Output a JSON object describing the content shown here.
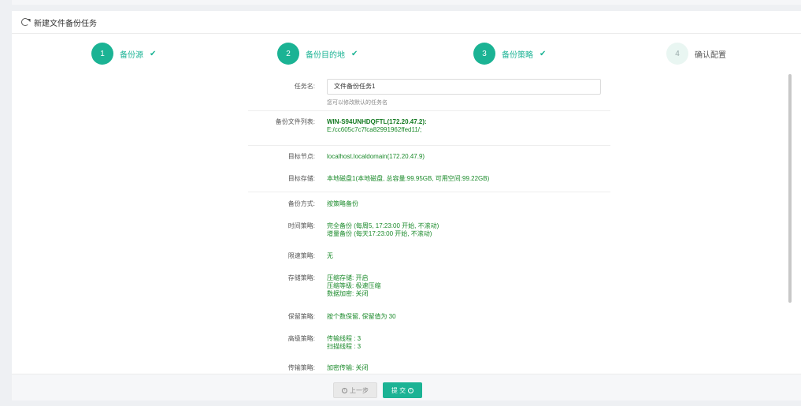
{
  "header": {
    "title": "新建文件备份任务"
  },
  "steps": [
    {
      "num": "1",
      "label": "备份源",
      "check": "✔",
      "state": "done"
    },
    {
      "num": "2",
      "label": "备份目的地",
      "check": "✔",
      "state": "done"
    },
    {
      "num": "3",
      "label": "备份策略",
      "check": "✔",
      "state": "done"
    },
    {
      "num": "4",
      "label": "确认配置",
      "check": "",
      "state": "current"
    }
  ],
  "form": {
    "task_name_label": "任务名:",
    "task_name_value": "文件备份任务1",
    "task_name_hint": "您可以修改默认的任务名",
    "file_list_label": "备份文件列表:",
    "file_list_host": "WIN-S94UNHDQFTL(172.20.47.2):",
    "file_list_path": "E:/cc605c7c7fca82991962ffed11/;",
    "target_node_label": "目标节点:",
    "target_node_value": "localhost.localdomain(172.20.47.9)",
    "target_storage_label": "目标存储:",
    "target_storage_value": "本地磁盘1(本地磁盘, 总容量:99.95GB, 可用空间:99.22GB)",
    "backup_mode_label": "备份方式:",
    "backup_mode_value": "按策略备份",
    "time_policy_label": "时间策略:",
    "time_policy_line1": "完全备份 (每周5, 17:23:00 开始, 不滚动)",
    "time_policy_line2": "增量备份 (每天17:23:00 开始, 不滚动)",
    "speed_policy_label": "限速策略:",
    "speed_policy_value": "无",
    "storage_policy_label": "存储策略:",
    "storage_policy_line1": "压缩存储: 开启",
    "storage_policy_line2": "压缩等级: 极速压缩",
    "storage_policy_line3": "数据加密: 关闭",
    "retention_policy_label": "保留策略:",
    "retention_policy_value": "按个数保留, 保留值为 30",
    "advanced_policy_label": "高级策略:",
    "advanced_policy_line1": "传输线程 : 3",
    "advanced_policy_line2": "扫描线程 : 3",
    "transfer_policy_label": "传输策略:",
    "transfer_policy_value": "加密传输: 关闭"
  },
  "footer": {
    "prev_label": "上一步",
    "submit_label": "提 交"
  },
  "icons": {
    "refresh": "refresh-icon",
    "check": "check-icon",
    "prev": "circle-left-arrow-icon",
    "submit": "circle-right-arrow-icon"
  },
  "colors": {
    "accent": "#1bb394",
    "value_text": "#1a8a2a"
  }
}
